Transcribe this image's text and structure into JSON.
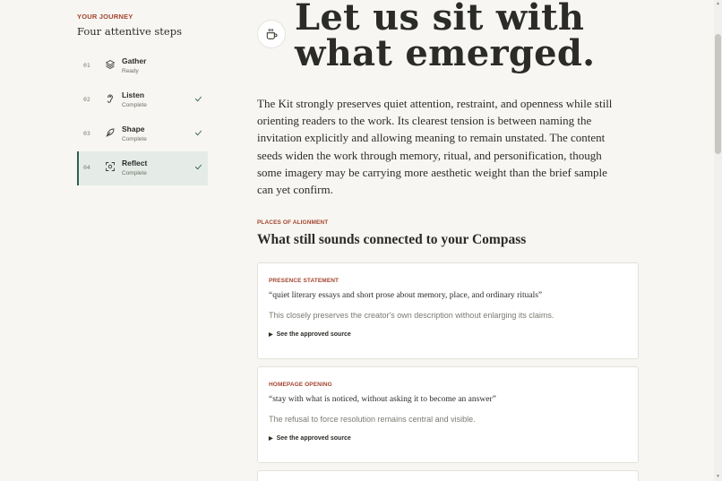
{
  "sidebar": {
    "eyebrow": "YOUR JOURNEY",
    "title": "Four attentive steps",
    "steps": [
      {
        "num": "01",
        "label": "Gather",
        "status": "Ready",
        "icon": "layers-icon",
        "complete": false,
        "active": false
      },
      {
        "num": "02",
        "label": "Listen",
        "status": "Complete",
        "icon": "ear-icon",
        "complete": true,
        "active": false
      },
      {
        "num": "03",
        "label": "Shape",
        "status": "Complete",
        "icon": "feather-icon",
        "complete": true,
        "active": false
      },
      {
        "num": "04",
        "label": "Reflect",
        "status": "Complete",
        "icon": "focus-icon",
        "complete": true,
        "active": true
      }
    ]
  },
  "hero": {
    "icon": "coffee-cup-icon",
    "title": "Let us sit with what emerged."
  },
  "lead": "The Kit strongly preserves quiet attention, restraint, and openness while still orienting readers to the work. Its clearest tension is between naming the invitation explicitly and allowing meaning to remain unstated. The content seeds widen the work through memory, ritual, and personification, though some imagery may be carrying more aesthetic weight than the brief sample can yet confirm.",
  "alignment": {
    "eyebrow": "PLACES OF ALIGNMENT",
    "title": "What still sounds connected to your Compass",
    "cards": [
      {
        "eyebrow": "PRESENCE STATEMENT",
        "quote": "“quiet literary essays and short prose about memory, place, and ordinary rituals”",
        "note": "This closely preserves the creator's own description without enlarging its claims.",
        "link": "See the approved source"
      },
      {
        "eyebrow": "HOMEPAGE OPENING",
        "quote": "“stay with what is noticed, without asking it to become an answer”",
        "note": "The refusal to force resolution remains central and visible.",
        "link": "See the approved source"
      }
    ]
  },
  "colors": {
    "accent": "#a4452f",
    "active_bg": "#e5ece8",
    "active_border": "#2d5e4f",
    "check": "#2d5e4f",
    "background": "#f7f6f2"
  }
}
